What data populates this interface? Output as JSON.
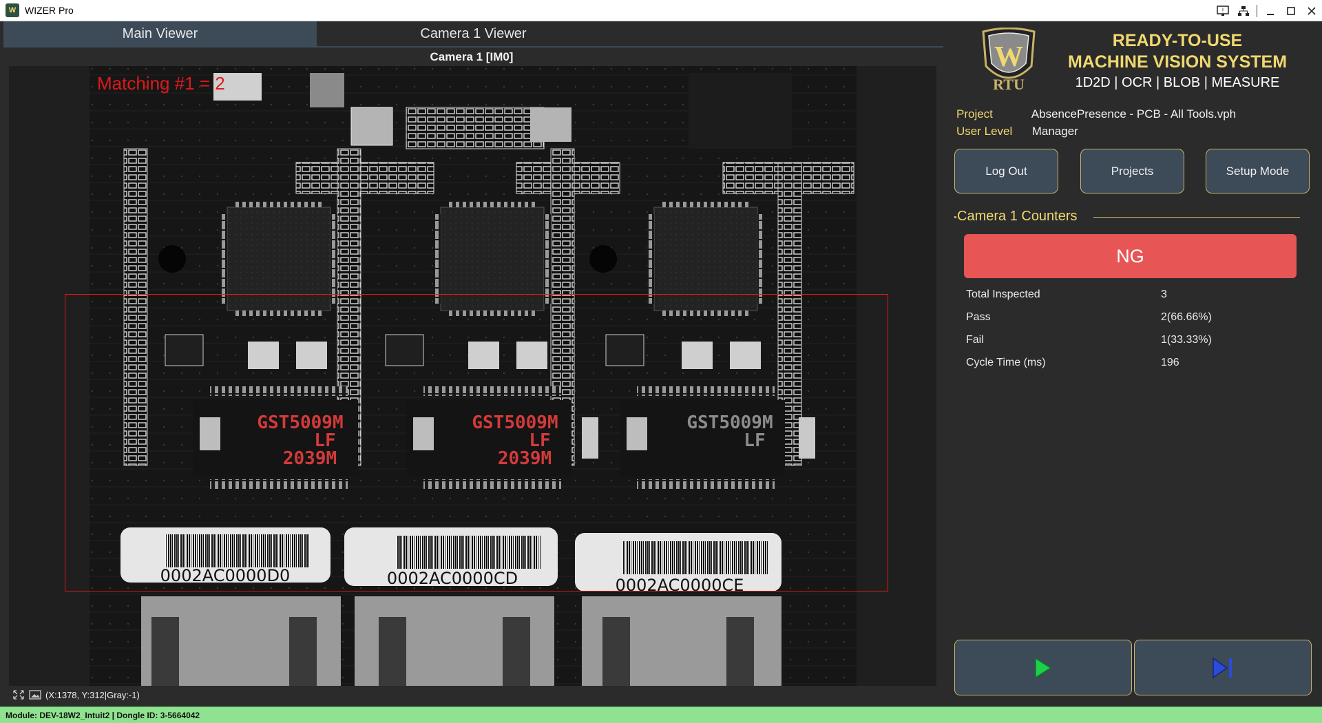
{
  "window": {
    "title": "WIZER Pro",
    "icon": "wizer-app-icon"
  },
  "title_controls": [
    "display-icon",
    "network-icon",
    "minimize-icon",
    "maximize-icon",
    "close-icon"
  ],
  "tabs": [
    {
      "label": "Main Viewer",
      "active": true
    },
    {
      "label": "Camera 1 Viewer",
      "active": false
    }
  ],
  "viewer": {
    "title": "Camera 1  [IM0]",
    "overlay_text": "Matching #1 = 2",
    "overlay_color": "#e01919",
    "coord_readout": "(X:1378, Y:312|Gray:-1)"
  },
  "status_bar": {
    "text": "Module: DEV-18W2_Intuit2 | Dongle ID: 3-5664042",
    "color": "#8fe28f"
  },
  "brand": {
    "logo_letters": "W",
    "logo_text": "RTU",
    "headline_line1": "READY-TO-USE",
    "headline_line2": "MACHINE VISION SYSTEM",
    "subline": "1D2D | OCR | BLOB | MEASURE",
    "accent": "#f0d870"
  },
  "info": {
    "project_label": "Project",
    "project_value": "AbsencePresence - PCB - All Tools.vph",
    "user_level_label": "User Level",
    "user_level_value": "Manager"
  },
  "buttons": {
    "logout": "Log Out",
    "projects": "Projects",
    "setup": "Setup Mode"
  },
  "counters": {
    "title": "Camera 1 Counters",
    "result": "NG",
    "result_color": "#e85555",
    "rows": [
      {
        "label": "Total Inspected",
        "value": "3"
      },
      {
        "label": "Pass",
        "value": "2(66.66%)"
      },
      {
        "label": "Fail",
        "value": "1(33.33%)"
      },
      {
        "label": "Cycle Time (ms)",
        "value": "196"
      }
    ]
  },
  "pcb_text": {
    "chips": [
      {
        "l1": "GST5009M",
        "l2": "LF",
        "l3": "2039M"
      },
      {
        "l1": "GST5009M",
        "l2": "LF",
        "l3": "2039M"
      },
      {
        "l1": "GST5009M",
        "l2": "LF",
        "l3": ""
      }
    ],
    "barcodes": [
      "0002AC0000D0",
      "0002AC0000CD",
      "0002AC0000CE"
    ]
  },
  "playback": {
    "run_icon": "play-icon",
    "step_icon": "step-forward-icon"
  }
}
